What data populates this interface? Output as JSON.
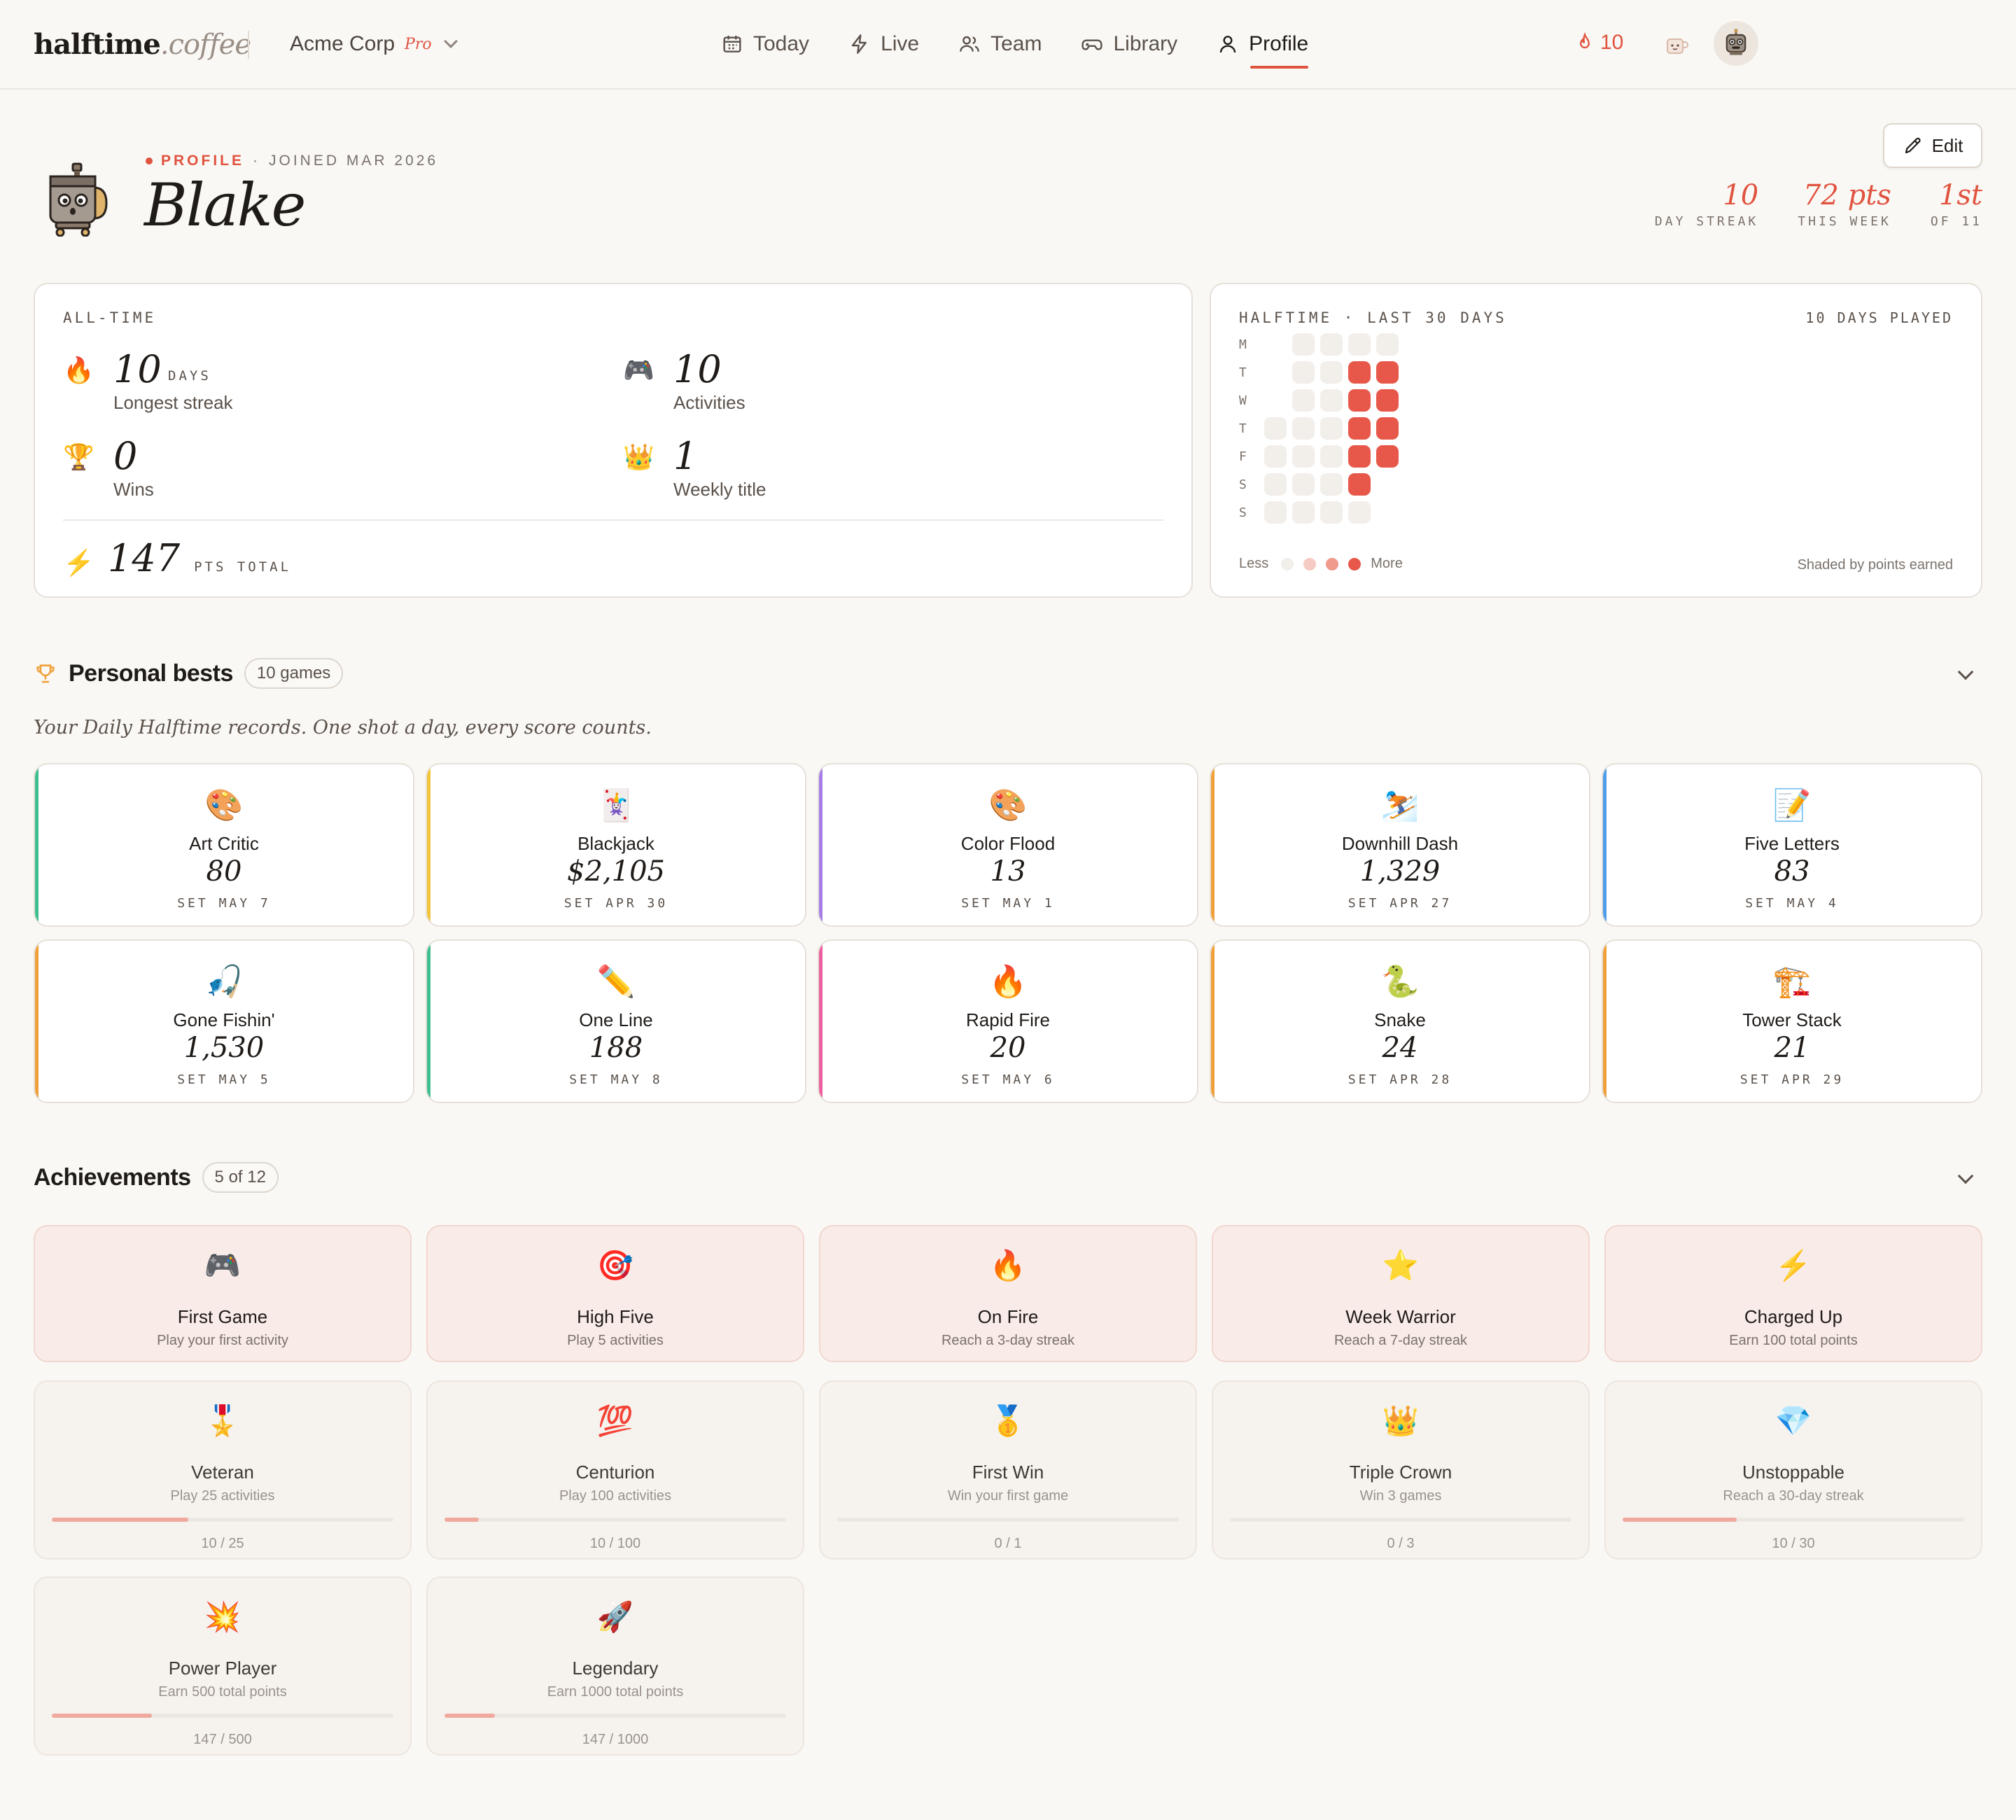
{
  "brand": {
    "name": "halftime",
    "suffix": ".coffee"
  },
  "org": {
    "name": "Acme Corp",
    "plan": "Pro"
  },
  "nav": [
    {
      "label": "Today",
      "icon": "calendar-icon"
    },
    {
      "label": "Live",
      "icon": "bolt-icon"
    },
    {
      "label": "Team",
      "icon": "team-icon"
    },
    {
      "label": "Library",
      "icon": "gamepad-icon"
    },
    {
      "label": "Profile",
      "icon": "user-icon",
      "active": true
    }
  ],
  "header_streak": "10",
  "edit_label": "Edit",
  "profile": {
    "eyebrow": "PROFILE",
    "joined": "JOINED MAR 2026",
    "name": "Blake",
    "stats": [
      {
        "value": "10",
        "label": "DAY STREAK"
      },
      {
        "value": "72 pts",
        "label": "THIS WEEK"
      },
      {
        "value": "1st",
        "label": "OF 11"
      }
    ]
  },
  "alltime": {
    "title": "ALL-TIME",
    "streak": {
      "value": "10",
      "unit": "DAYS",
      "label": "Longest streak"
    },
    "activities": {
      "value": "10",
      "label": "Activities"
    },
    "wins": {
      "value": "0",
      "label": "Wins"
    },
    "weekly": {
      "value": "1",
      "label": "Weekly title"
    },
    "total": {
      "value": "147",
      "unit": "PTS TOTAL"
    }
  },
  "heatmap": {
    "title": "HALFTIME · LAST 30 DAYS",
    "played": "10 DAYS PLAYED",
    "days": [
      "M",
      "T",
      "W",
      "T",
      "F",
      "S",
      "S"
    ],
    "legend_less": "Less",
    "legend_more": "More",
    "note": "Shaded by points earned",
    "colors": {
      "empty": "#f2eeea",
      "high": "#e8584a"
    }
  },
  "personal_bests": {
    "title": "Personal bests",
    "count": "10 games",
    "subtitle": "Your Daily Halftime records. One shot a day, every score counts.",
    "items": [
      {
        "emoji": "🎨",
        "name": "Art Critic",
        "score": "80",
        "date": "SET MAY 7",
        "color": "#3fbf8f"
      },
      {
        "emoji": "🃏",
        "name": "Blackjack",
        "score": "$2,105",
        "date": "SET APR 30",
        "color": "#f0c53a"
      },
      {
        "emoji": "🎨",
        "name": "Color Flood",
        "score": "13",
        "date": "SET MAY 1",
        "color": "#a57ee8"
      },
      {
        "emoji": "⛷️",
        "name": "Downhill Dash",
        "score": "1,329",
        "date": "SET APR 27",
        "color": "#f0a03a"
      },
      {
        "emoji": "📝",
        "name": "Five Letters",
        "score": "83",
        "date": "SET MAY 4",
        "color": "#4d9de8"
      },
      {
        "emoji": "🎣",
        "name": "Gone Fishin'",
        "score": "1,530",
        "date": "SET MAY 5",
        "color": "#f0a03a"
      },
      {
        "emoji": "✏️",
        "name": "One Line",
        "score": "188",
        "date": "SET MAY 8",
        "color": "#3fbf8f"
      },
      {
        "emoji": "🔥",
        "name": "Rapid Fire",
        "score": "20",
        "date": "SET MAY 6",
        "color": "#ee5fa0"
      },
      {
        "emoji": "🐍",
        "name": "Snake",
        "score": "24",
        "date": "SET APR 28",
        "color": "#f0a03a"
      },
      {
        "emoji": "🏗️",
        "name": "Tower Stack",
        "score": "21",
        "date": "SET APR 29",
        "color": "#f0a03a"
      }
    ]
  },
  "achievements": {
    "title": "Achievements",
    "count": "5 of 12",
    "items": [
      {
        "emoji": "🎮",
        "name": "First Game",
        "desc": "Play your first activity",
        "done": true
      },
      {
        "emoji": "🎯",
        "name": "High Five",
        "desc": "Play 5 activities",
        "done": true
      },
      {
        "emoji": "🔥",
        "name": "On Fire",
        "desc": "Reach a 3-day streak",
        "done": true
      },
      {
        "emoji": "⭐",
        "name": "Week Warrior",
        "desc": "Reach a 7-day streak",
        "done": true
      },
      {
        "emoji": "⚡",
        "name": "Charged Up",
        "desc": "Earn 100 total points",
        "done": true
      },
      {
        "emoji": "🎖️",
        "name": "Veteran",
        "desc": "Play 25 activities",
        "progress": "10 / 25",
        "fraction": 0.4
      },
      {
        "emoji": "💯",
        "name": "Centurion",
        "desc": "Play 100 activities",
        "progress": "10 / 100",
        "fraction": 0.1
      },
      {
        "emoji": "🥇",
        "name": "First Win",
        "desc": "Win your first game",
        "progress": "0 / 1",
        "fraction": 0
      },
      {
        "emoji": "👑",
        "name": "Triple Crown",
        "desc": "Win 3 games",
        "progress": "0 / 3",
        "fraction": 0
      },
      {
        "emoji": "💎",
        "name": "Unstoppable",
        "desc": "Reach a 30-day streak",
        "progress": "10 / 30",
        "fraction": 0.333
      },
      {
        "emoji": "💥",
        "name": "Power Player",
        "desc": "Earn 500 total points",
        "progress": "147 / 500",
        "fraction": 0.294
      },
      {
        "emoji": "🚀",
        "name": "Legendary",
        "desc": "Earn 1000 total points",
        "progress": "147 / 1000",
        "fraction": 0.147
      }
    ]
  }
}
